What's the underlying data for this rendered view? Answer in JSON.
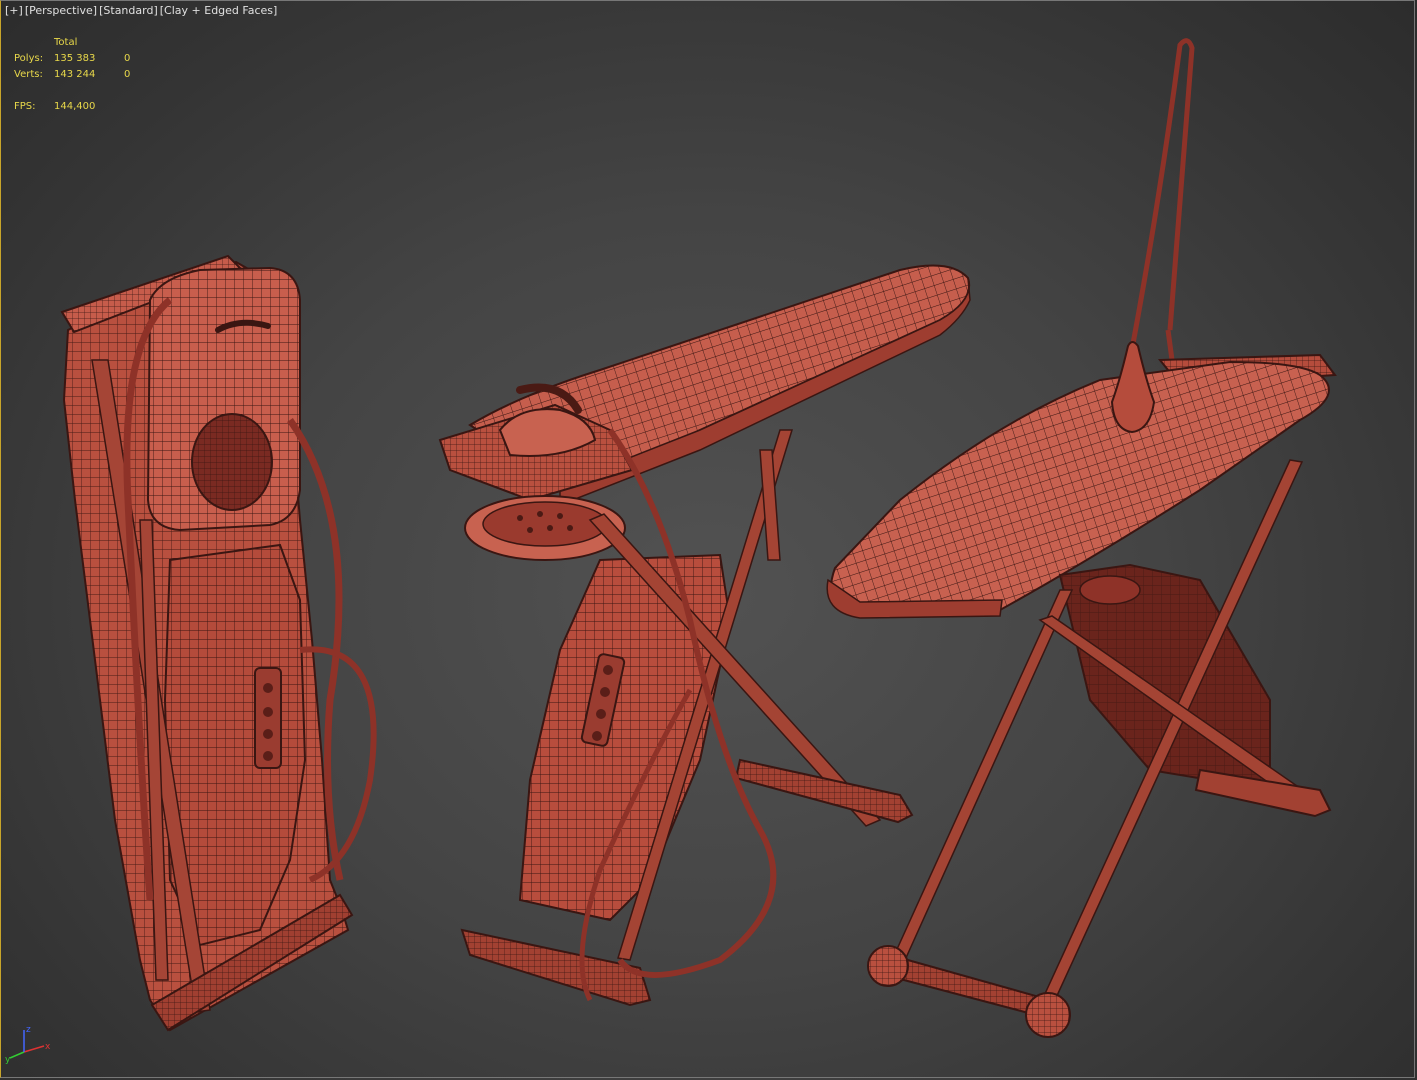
{
  "viewport": {
    "labels": [
      "[+]",
      "[Perspective]",
      "[Standard]",
      "[Clay + Edged Faces]"
    ]
  },
  "stats": {
    "header": "Total",
    "polys_label": "Polys:",
    "polys_total": "135 383",
    "polys_sel": "0",
    "verts_label": "Verts:",
    "verts_total": "143 244",
    "verts_sel": "0",
    "fps_label": "FPS:",
    "fps_value": "144,400"
  },
  "colors": {
    "clay": "#c4584a",
    "clay_dark": "#8e3228",
    "wire": "#3a1612",
    "stats_text": "#e8d84a"
  },
  "gizmo": {
    "x": "x",
    "y": "y",
    "z": "z"
  }
}
